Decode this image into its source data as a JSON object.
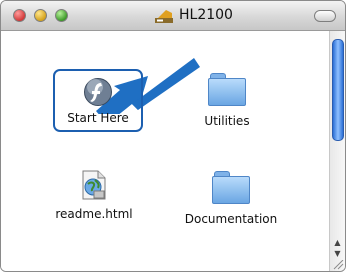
{
  "window": {
    "title": "HL2100"
  },
  "items": [
    {
      "label": "Start Here",
      "icon": "flash-icon"
    },
    {
      "label": "Utilities",
      "icon": "folder-icon"
    },
    {
      "label": "readme.html",
      "icon": "html-document-icon"
    },
    {
      "label": "Documentation",
      "icon": "folder-icon"
    }
  ],
  "colors": {
    "selection": "#1c5fb0",
    "arrow": "#1f6fc3"
  }
}
